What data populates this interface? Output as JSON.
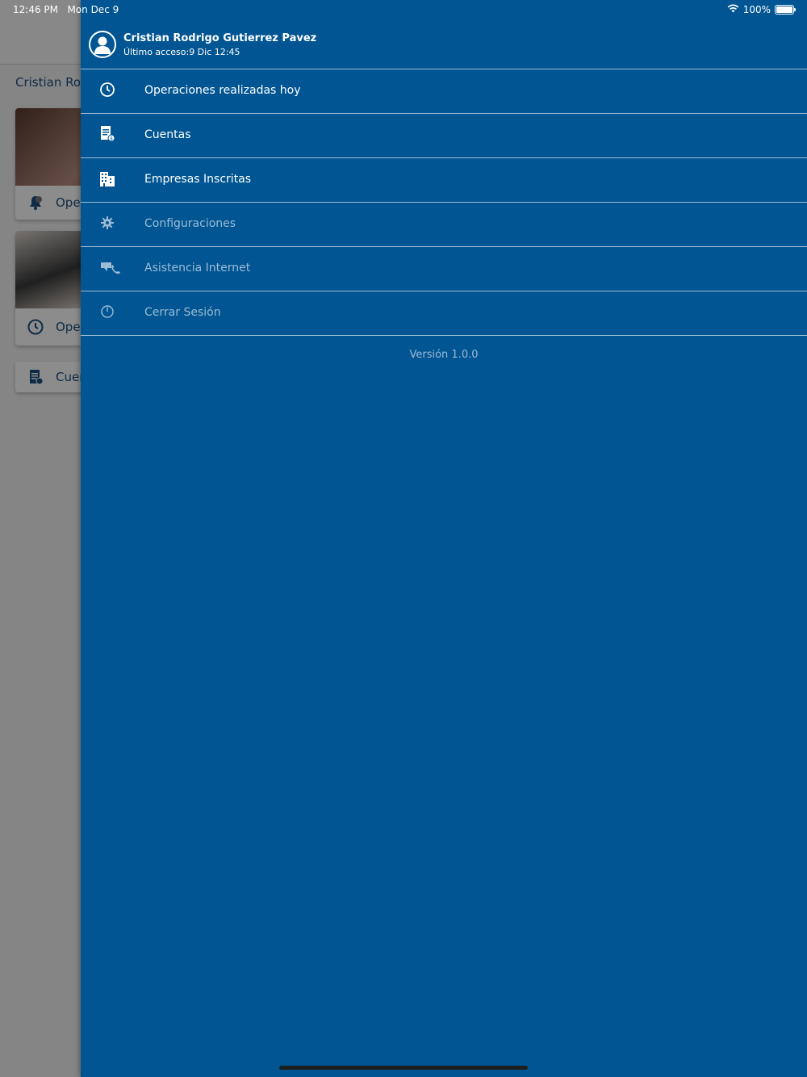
{
  "status_bar": {
    "time": "12:46 PM",
    "date": "Mon Dec 9",
    "battery": "100%"
  },
  "background": {
    "user_name_partial": "Cristian Roc",
    "cards": [
      {
        "row_label": "Opera"
      },
      {
        "row_label": "Ope"
      }
    ],
    "list_item": "Cuer"
  },
  "drawer": {
    "profile": {
      "name": "Cristian Rodrigo Gutierrez Pavez",
      "last_access": "Último acceso:9 Dic 12:45"
    },
    "menu": [
      {
        "label": "Operaciones realizadas hoy",
        "icon": "clock-icon",
        "state": "active"
      },
      {
        "label": "Cuentas",
        "icon": "document-icon",
        "state": "active"
      },
      {
        "label": "Empresas Inscritas",
        "icon": "building-icon",
        "state": "active"
      },
      {
        "label": "Configuraciones",
        "icon": "gear-icon",
        "state": "disabled"
      },
      {
        "label": "Asistencia Internet",
        "icon": "phone-support-icon",
        "state": "disabled"
      },
      {
        "label": "Cerrar Sesión",
        "icon": "power-icon",
        "state": "disabled"
      }
    ],
    "version": "Versión 1.0.0"
  },
  "colors": {
    "drawer_bg": "#005592",
    "active_text": "#ffffff",
    "disabled_text": "#9dbbd5",
    "divider": "#9fbdd6"
  }
}
